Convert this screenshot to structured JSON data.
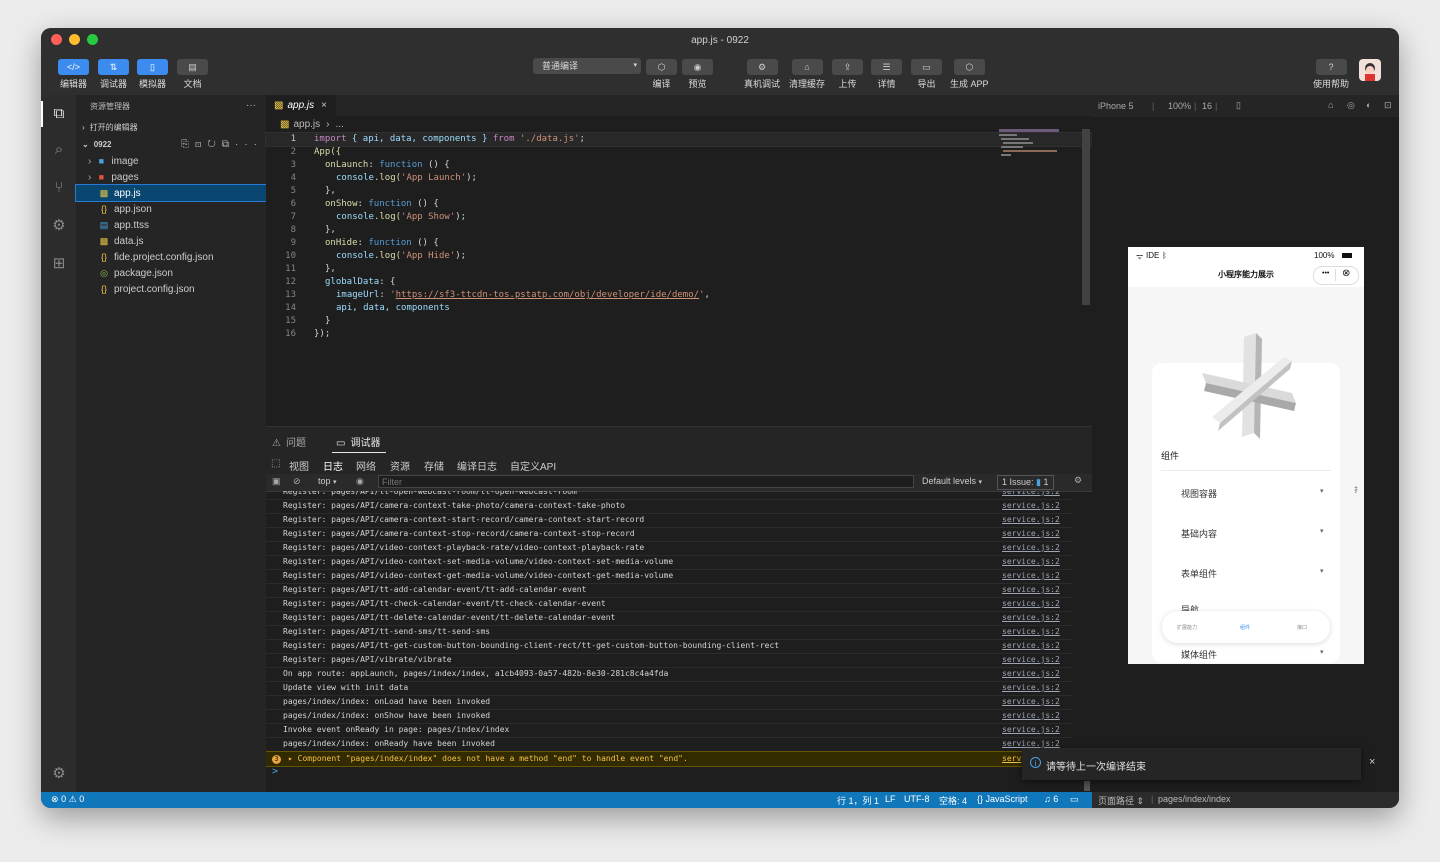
{
  "window": {
    "title": "app.js - 0922",
    "traffic_colors": [
      "#ff5f57",
      "#febc2e",
      "#28c840"
    ]
  },
  "toolbar": {
    "left_buttons": [
      {
        "label": "编辑器",
        "icon": "</>",
        "active": true
      },
      {
        "label": "调试器",
        "icon": "⇅",
        "active": true
      },
      {
        "label": "模拟器",
        "icon": "▯",
        "active": true
      },
      {
        "label": "文档",
        "icon": "▤",
        "active": false
      }
    ],
    "compile_mode": "普通编译",
    "center_buttons": [
      {
        "label": "编译",
        "icon": "⬡"
      },
      {
        "label": "预览",
        "icon": "◉"
      }
    ],
    "right_buttons": [
      {
        "label": "真机调试",
        "icon": "⚙"
      },
      {
        "label": "清理缓存",
        "icon": "⌂"
      },
      {
        "label": "上传",
        "icon": "⇪"
      },
      {
        "label": "详情",
        "icon": "☰"
      },
      {
        "label": "导出",
        "icon": "▭"
      },
      {
        "label": "生成 APP",
        "icon": "⬡"
      }
    ],
    "help_label": "使用帮助",
    "help_icon": "?"
  },
  "sidebar": {
    "title": "资源管理器",
    "more": "···",
    "open_editors": "打开的编辑器",
    "project": "0922",
    "files": [
      {
        "name": "image",
        "icon": "▸",
        "color": "#4aa3df"
      },
      {
        "name": "pages",
        "icon": "▸",
        "color": "#e2533b"
      },
      {
        "name": "app.js",
        "icon": "JS",
        "color": "#e8c547"
      },
      {
        "name": "app.json",
        "icon": "{}",
        "color": "#e8c547"
      },
      {
        "name": "app.ttss",
        "icon": "▤",
        "color": "#4aa3df"
      },
      {
        "name": "data.js",
        "icon": "JS",
        "color": "#e8c547"
      },
      {
        "name": "fide.project.config.json",
        "icon": "{}",
        "color": "#e8c547"
      },
      {
        "name": "package.json",
        "icon": "◎",
        "color": "#8bc34a"
      },
      {
        "name": "project.config.json",
        "icon": "{}",
        "color": "#e8c547"
      }
    ]
  },
  "editor": {
    "tab": "app.js",
    "tab_close": "×",
    "breadcrumb_file": "app.js",
    "breadcrumb_more": "...",
    "lines": [
      {
        "n": "1"
      },
      {
        "n": "2"
      },
      {
        "n": "3"
      },
      {
        "n": "4"
      },
      {
        "n": "5"
      },
      {
        "n": "6"
      },
      {
        "n": "7"
      },
      {
        "n": "8"
      },
      {
        "n": "9"
      },
      {
        "n": "10"
      },
      {
        "n": "11"
      },
      {
        "n": "12"
      },
      {
        "n": "13"
      },
      {
        "n": "14"
      },
      {
        "n": "15"
      },
      {
        "n": "16"
      }
    ],
    "code": {
      "l1_import": "import",
      "l1_mid": " { api, data, components } ",
      "l1_from": "from",
      "l1_path": "'./data.js'",
      "l1_end": ";",
      "l2": "App({",
      "l3_key": "onLaunch",
      "l3_fn": "function",
      "l3_rest": " () {",
      "l4_obj": "console",
      "l4_log": ".log(",
      "l4_str": "'App Launch'",
      "l4_end": ");",
      "l5": "},",
      "l6_key": "onShow",
      "l6_fn": "function",
      "l6_rest": " () {",
      "l7_obj": "console",
      "l7_log": ".log(",
      "l7_str": "'App Show'",
      "l7_end": ");",
      "l8": "},",
      "l9_key": "onHide",
      "l9_fn": "function",
      "l9_rest": " () {",
      "l10_obj": "console",
      "l10_log": ".log(",
      "l10_str": "'App Hide'",
      "l10_end": ");",
      "l11": "},",
      "l12_key": "globalData",
      "l12_rest": ": {",
      "l13_key": "imageUrl",
      "l13_q1": "'",
      "l13_url": "https://sf3-ttcdn-tos.pstatp.com/obj/developer/ide/demo/",
      "l13_q2": "'",
      "l13_end": ",",
      "l14": "api, data, components",
      "l15": "}",
      "l16": "});"
    }
  },
  "panel": {
    "tab_problems": "问题",
    "tab_debugger": "调试器",
    "subtabs": [
      "视图",
      "日志",
      "网络",
      "资源",
      "存储",
      "编译日志",
      "自定义API"
    ],
    "context": "top",
    "filter_placeholder": "Filter",
    "levels": "Default levels",
    "issues": "1 Issue:",
    "issues_count": "1",
    "logs": [
      {
        "msg": "Register: pages/API/tt-open-webcast-room/tt-open-webcast-room",
        "src": "service.js:2"
      },
      {
        "msg": "Register: pages/API/camera-context-take-photo/camera-context-take-photo",
        "src": "service.js:2"
      },
      {
        "msg": "Register: pages/API/camera-context-start-record/camera-context-start-record",
        "src": "service.js:2"
      },
      {
        "msg": "Register: pages/API/camera-context-stop-record/camera-context-stop-record",
        "src": "service.js:2"
      },
      {
        "msg": "Register: pages/API/video-context-playback-rate/video-context-playback-rate",
        "src": "service.js:2"
      },
      {
        "msg": "Register: pages/API/video-context-set-media-volume/video-context-set-media-volume",
        "src": "service.js:2"
      },
      {
        "msg": "Register: pages/API/video-context-get-media-volume/video-context-get-media-volume",
        "src": "service.js:2"
      },
      {
        "msg": "Register: pages/API/tt-add-calendar-event/tt-add-calendar-event",
        "src": "service.js:2"
      },
      {
        "msg": "Register: pages/API/tt-check-calendar-event/tt-check-calendar-event",
        "src": "service.js:2"
      },
      {
        "msg": "Register: pages/API/tt-delete-calendar-event/tt-delete-calendar-event",
        "src": "service.js:2"
      },
      {
        "msg": "Register: pages/API/tt-send-sms/tt-send-sms",
        "src": "service.js:2"
      },
      {
        "msg": "Register: pages/API/tt-get-custom-button-bounding-client-rect/tt-get-custom-button-bounding-client-rect",
        "src": "service.js:2"
      },
      {
        "msg": "Register: pages/API/vibrate/vibrate",
        "src": "service.js:2"
      },
      {
        "msg": "On app route: appLaunch, pages/index/index, a1cb4093-0a57-482b-8e30-281c8c4a4fda",
        "src": "service.js:2"
      },
      {
        "msg": "Update view with init data",
        "src": "service.js:2"
      },
      {
        "msg": "pages/index/index: onLoad have been invoked",
        "src": "service.js:2"
      },
      {
        "msg": "pages/index/index: onShow have been invoked",
        "src": "service.js:2"
      },
      {
        "msg": "Invoke event onReady in page: pages/index/index",
        "src": "service.js:2"
      },
      {
        "msg": "pages/index/index: onReady have been invoked",
        "src": "service.js:2"
      }
    ],
    "warning": {
      "count": "3",
      "msg": "▸ Component \"pages/index/index\" does not have a method \"end\" to handle event \"end\".",
      "src": "serv"
    },
    "prompt": ">"
  },
  "simulator": {
    "device": "iPhone 5",
    "zoom": "100%",
    "font": "16",
    "phone": {
      "carrier": "IDE",
      "battery": "100%",
      "title": "小程序能力展示",
      "menu_dots": "•••",
      "close": "⊗",
      "section": "组件",
      "items": [
        "视图容器",
        "基础内容",
        "表单组件",
        "导航",
        "媒体组件"
      ],
      "tabbar": [
        "扩展能力",
        "组件",
        "接口"
      ],
      "side_char": "扌"
    }
  },
  "toast": {
    "icon": "i",
    "msg": "请等待上一次编译结束",
    "close": "×"
  },
  "statusbar": {
    "errors": "0",
    "warnings": "0",
    "cursor": "行 1，列 1",
    "eol": "LF",
    "encoding": "UTF-8",
    "indent": "空格: 4",
    "language": "JavaScript",
    "notifications": "6",
    "page_path_label": "页面路径",
    "page_path": "pages/index/index"
  }
}
